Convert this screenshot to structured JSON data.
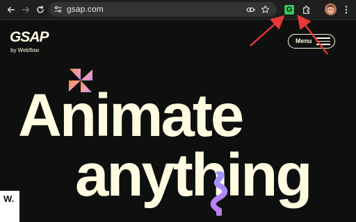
{
  "browser": {
    "url": "gsap.com",
    "extension_letter": "G",
    "icons": {
      "back": "arrow-left-icon",
      "forward": "arrow-right-icon",
      "reload": "reload-icon",
      "site_info": "tune-icon",
      "password": "key-icon",
      "bookmark": "star-icon",
      "extension": "gsap-extension-icon",
      "extensions_menu": "puzzle-icon",
      "profile": "profile-avatar",
      "menu": "more-vertical-icon"
    }
  },
  "site": {
    "logo": "GSAP",
    "logo_sub": "by Webflow",
    "menu_label": "Menu",
    "headline_line1": "Animate",
    "headline_line2": "anything",
    "badge_letter": "W."
  },
  "colors": {
    "background": "#0e100f",
    "text": "#fffce1",
    "toolbar": "#1f1f20",
    "omnibox": "#333336",
    "extension_green": "#38c75a",
    "annotation_red": "#e53935"
  }
}
